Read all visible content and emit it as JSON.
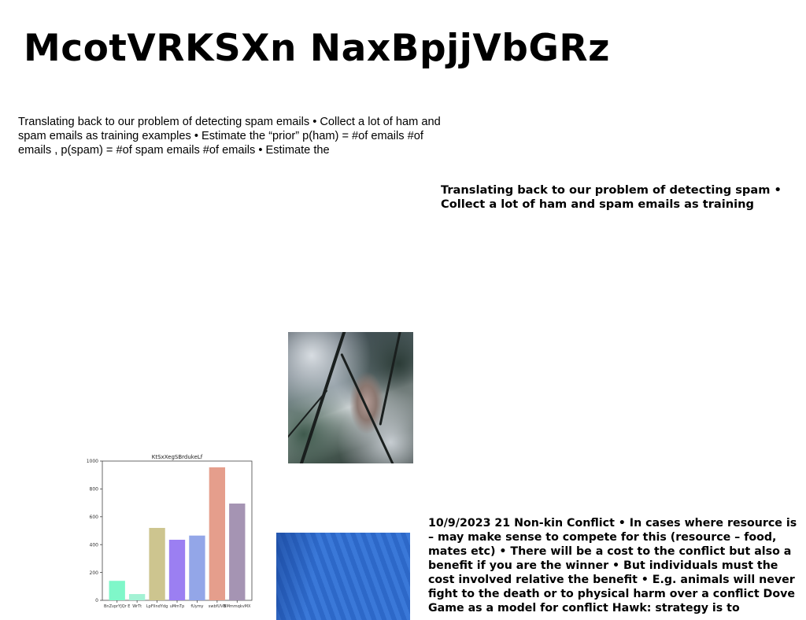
{
  "title": "McotVRKSXn NaxBpjjVbGRz",
  "paragraphs": {
    "p1": "Translating back to our problem of detecting spam emails • Collect a lot of ham and spam emails as training examples • Estimate the “prior” p(ham) = #of emails #of emails , p(spam) = #of spam emails #of emails • Estimate the",
    "p2": "Translating back to our problem of detecting spam • Collect a lot of ham and spam emails as training",
    "p3": "10/9/2023 21 Non-kin Conflict • In cases where resource is – may make sense to compete for this (resource – food, mates etc) • There will be a cost to the conflict but also a benefit if you are the winner • But individuals must the cost involved relative the benefit • E.g. animals will never fight to the death or to physical harm over a conflict Dove Game as a model for conflict Hawk: strategy is to"
  },
  "chart_data": {
    "type": "bar",
    "title": "KtSxXegSBrdukeLf",
    "categories": [
      "BnZvprYJQr E",
      "WrTt",
      "LpFllndYdg",
      "uMmTp",
      "fUymy",
      "swbfUVB",
      "BMmmqkvMX"
    ],
    "values": [
      140,
      45,
      520,
      435,
      465,
      955,
      695
    ],
    "colors": [
      "#7ff7c9",
      "#a3f2d4",
      "#cdc58f",
      "#9b7ff2",
      "#93a6e8",
      "#e59e8c",
      "#a594b3"
    ],
    "ylim": [
      0,
      1000
    ],
    "yticks": [
      0,
      200,
      400,
      600,
      800,
      1000
    ],
    "xlabel": "",
    "ylabel": ""
  }
}
